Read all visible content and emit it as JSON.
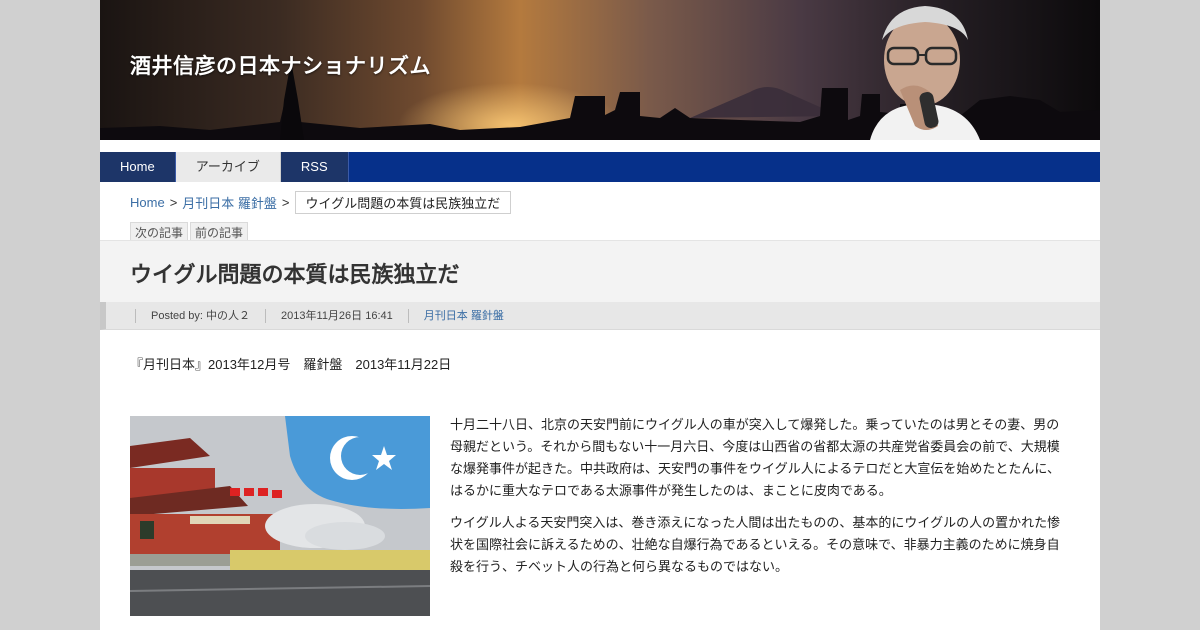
{
  "site": {
    "title": "酒井信彦の日本ナショナリズム"
  },
  "nav": [
    {
      "label": "Home"
    },
    {
      "label": "アーカイブ"
    },
    {
      "label": "RSS"
    }
  ],
  "breadcrumb": {
    "home": "Home",
    "sep": ">",
    "category": "月刊日本 羅針盤",
    "current": "ウイグル問題の本質は民族独立だ"
  },
  "pager": {
    "next": "次の記事",
    "prev": "前の記事"
  },
  "post": {
    "title": "ウイグル問題の本質は民族独立だ",
    "posted_by": "Posted by: 中の人２",
    "date": "2013年11月26日 16:41",
    "category": "月刊日本 羅針盤",
    "source": "『月刊日本』2013年12月号　羅針盤　2013年11月22日",
    "paragraphs": [
      "十月二十八日、北京の天安門前にウイグル人の車が突入して爆発した。乗っていたのは男とその妻、男の母親だという。それから間もない十一月六日、今度は山西省の省都太源の共産党省委員会の前で、大規模な爆発事件が起きた。中共政府は、天安門の事件をウイグル人によるテロだと大宣伝を始めたとたんに、はるかに重大なテロである太源事件が発生したのは、まことに皮肉である。",
      "ウイグル人よる天安門突入は、巻き添えになった人間は出たものの、基本的にウイグルの人の置かれた惨状を国際社会に訴えるための、壮絶な自爆行為であるといえる。その意味で、非暴力主義のために焼身自殺を行う、チベット人の行為と何ら異なるものではない。"
    ]
  },
  "colors": {
    "nav": "#06308a",
    "link": "#3b6ea5",
    "flag": "#4a9ad8"
  }
}
